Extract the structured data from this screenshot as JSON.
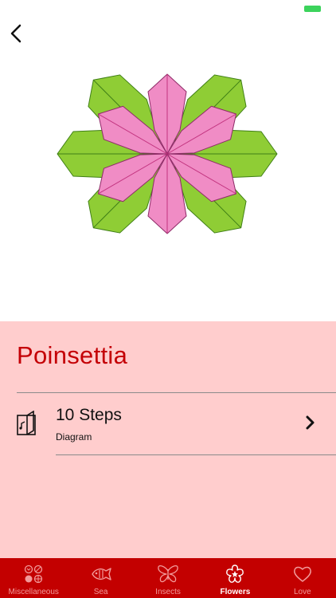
{
  "colors": {
    "accent": "#c40006",
    "panel_bg": "#ffcdcd",
    "tabbar_bg": "#c30000",
    "tab_inactive": "#f29a9a",
    "tab_active": "#ffffff",
    "battery": "#3cd35c",
    "leaf_green": "#8fcd35",
    "petal_pink": "#f08cc5"
  },
  "header": {
    "back_icon": "chevron-left-icon"
  },
  "model": {
    "title": "Poinsettia",
    "steps_label": "10 Steps",
    "steps_sub": "Diagram",
    "steps_icon": "diagram-book-icon",
    "chevron_icon": "chevron-right-icon"
  },
  "tabs": [
    {
      "label": "Miscellaneous",
      "icon": "shapes-icon",
      "active": false
    },
    {
      "label": "Sea",
      "icon": "fish-icon",
      "active": false
    },
    {
      "label": "Insects",
      "icon": "butterfly-icon",
      "active": false
    },
    {
      "label": "Flowers",
      "icon": "flower-icon",
      "active": true
    },
    {
      "label": "Love",
      "icon": "heart-icon",
      "active": false
    }
  ]
}
